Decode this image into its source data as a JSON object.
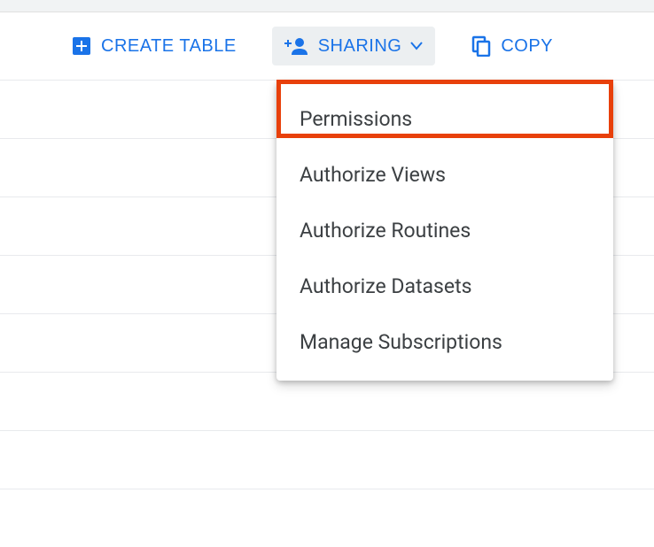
{
  "toolbar": {
    "create_table_label": "Create Table",
    "sharing_label": "Sharing",
    "copy_label": "Copy"
  },
  "sharing_menu": {
    "items": [
      {
        "label": "Permissions"
      },
      {
        "label": "Authorize Views"
      },
      {
        "label": "Authorize Routines"
      },
      {
        "label": "Authorize Datasets"
      },
      {
        "label": "Manage Subscriptions"
      }
    ]
  },
  "highlight": {
    "target": "Permissions"
  }
}
